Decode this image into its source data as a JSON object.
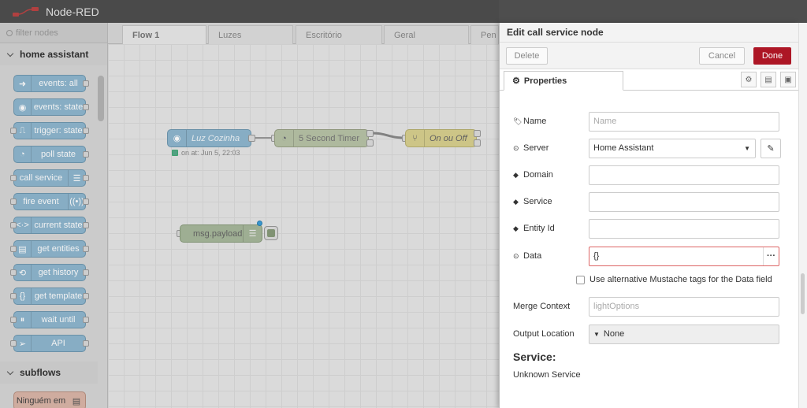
{
  "app": {
    "title": "Node-RED"
  },
  "palette": {
    "filter_placeholder": "filter nodes",
    "category_home_assistant": "home assistant",
    "category_subflows": "subflows",
    "nodes": [
      {
        "label": "events: all",
        "icon": "arrow-right-icon"
      },
      {
        "label": "events: state",
        "icon": "circle-arrow-icon"
      },
      {
        "label": "trigger: state",
        "icon": "signal-icon"
      },
      {
        "label": "poll state",
        "icon": "timer-icon"
      },
      {
        "label": "call service",
        "icon": "router-icon"
      },
      {
        "label": "fire event",
        "icon": "broadcast-icon"
      },
      {
        "label": "current state",
        "icon": "code-icon"
      },
      {
        "label": "get entities",
        "icon": "list-icon"
      },
      {
        "label": "get history",
        "icon": "history-icon"
      },
      {
        "label": "get template",
        "icon": "file-code-icon"
      },
      {
        "label": "wait until",
        "icon": "pause-icon"
      },
      {
        "label": "API",
        "icon": "send-icon"
      }
    ],
    "subflow_nodes": [
      {
        "label": "Ninguém em"
      }
    ]
  },
  "workspace": {
    "tabs": [
      "Flow 1",
      "Luzes",
      "Escritório",
      "Geral",
      "Pen"
    ],
    "active_tab": "Flow 1",
    "flow_nodes": {
      "luz_cozinha": "Luz Cozinha",
      "luz_cozinha_status": "on at: Jun 5, 22:03",
      "timer": "5 Second Timer",
      "switch": "On ou Off",
      "debug": "msg.payload"
    }
  },
  "editor": {
    "title": "Edit call service node",
    "delete_label": "Delete",
    "cancel_label": "Cancel",
    "done_label": "Done",
    "properties_tab": "Properties",
    "fields": {
      "name_label": "Name",
      "name_placeholder": "Name",
      "server_label": "Server",
      "server_value": "Home Assistant",
      "domain_label": "Domain",
      "service_label": "Service",
      "entity_label": "Entity Id",
      "data_label": "Data",
      "data_value": "{}",
      "mustache_label": "Use alternative Mustache tags for the Data field",
      "merge_label": "Merge Context",
      "merge_placeholder": "lightOptions",
      "output_label": "Output Location",
      "output_value": "None"
    },
    "service_heading": "Service:",
    "service_text": "Unknown Service"
  },
  "colors": {
    "header": "#4e4e4e",
    "ha_node": "#8fb7cf",
    "done_button": "#ad1625"
  }
}
